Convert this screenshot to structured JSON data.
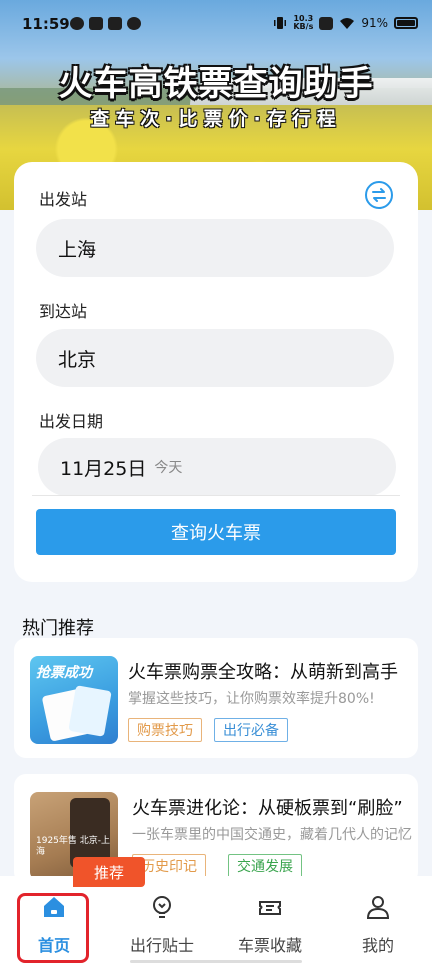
{
  "status_bar": {
    "time": "11:59",
    "net_speed": "10.3",
    "net_unit": "KB/s",
    "battery": "91%"
  },
  "hero": {
    "title": "火车高铁票查询助手",
    "subtitle": "查车次·比票价·存行程"
  },
  "search": {
    "from_label": "出发站",
    "from_value": "上海",
    "to_label": "到达站",
    "to_value": "北京",
    "date_label": "出发日期",
    "date_value": "11月25日",
    "date_sub": "今天",
    "query_button": "查询火车票"
  },
  "hot": {
    "title": "热门推荐",
    "items": [
      {
        "title": "火车票购票全攻略：从萌新到高手",
        "desc": "掌握这些技巧，让你购票效率提升80%!",
        "thumb_text": "抢票成功",
        "tags": [
          "购票技巧",
          "出行必备"
        ]
      },
      {
        "title": "火车票进化论：从硬板票到“刷脸”",
        "desc": "一张车票里的中国交通史，藏着几代人的记忆",
        "thumb_text": "1925年售 北京-上海",
        "tags": [
          "历史印记",
          "交通发展"
        ]
      }
    ]
  },
  "badge": "推荐",
  "nav": {
    "items": [
      {
        "label": "首页",
        "icon": "home-icon"
      },
      {
        "label": "出行贴士",
        "icon": "lightbulb-icon"
      },
      {
        "label": "车票收藏",
        "icon": "ticket-icon"
      },
      {
        "label": "我的",
        "icon": "user-icon"
      }
    ]
  },
  "colors": {
    "accent": "#2b9bea",
    "nav_active": "#2b8fe0",
    "highlight": "#e2232b",
    "badge": "#f0542a"
  }
}
